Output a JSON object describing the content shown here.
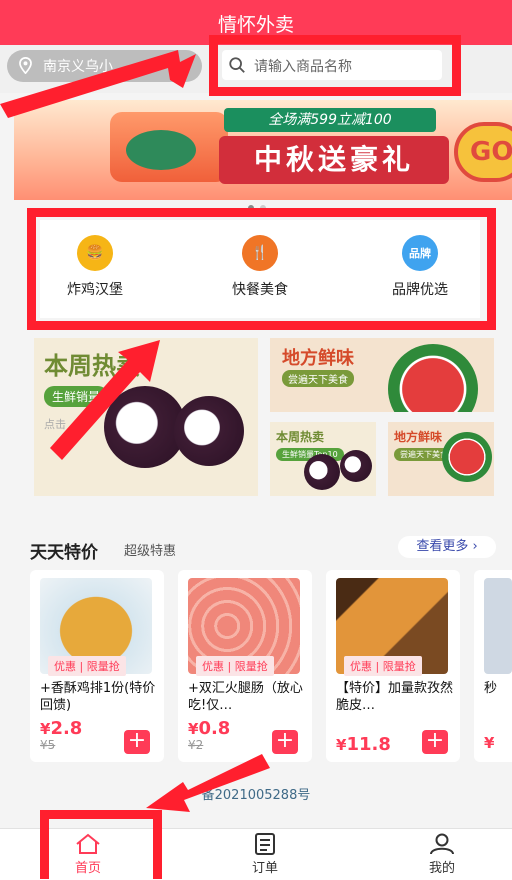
{
  "header": {
    "title": "情怀外卖",
    "bg_color": "#ff3b57"
  },
  "location": {
    "text": "南京义乌小",
    "icon": "location-pin-icon",
    "chevron": "›"
  },
  "search": {
    "placeholder": "请输入商品名称",
    "icon": "search-icon"
  },
  "banner": {
    "deal": "全场满599立减100",
    "headline": "中秋送豪礼",
    "go": "GO"
  },
  "categories": [
    {
      "label": "炸鸡汉堡",
      "icon": "fried-chicken-icon",
      "color": "#f6b516",
      "glyph": "🍔"
    },
    {
      "label": "快餐美食",
      "icon": "fork-knife-icon",
      "color": "#f07526",
      "glyph": "🍴"
    },
    {
      "label": "品牌优选",
      "icon": "brand-icon",
      "color": "#3fa3ef",
      "glyph": "品牌"
    }
  ],
  "promos": {
    "big": {
      "title": "本周热卖",
      "tag": "生鲜销量",
      "sub": "点击"
    },
    "top_right": {
      "title": "地方鲜味",
      "tag": "尝遍天下美食"
    },
    "small_left": {
      "title": "本周热卖",
      "tag": "生鲜销量Top10"
    },
    "small_right": {
      "title": "地方鲜味",
      "tag": "尝遍天下美食"
    }
  },
  "daily": {
    "title": "天天特价",
    "subtitle": "超级特惠",
    "more": "查看更多",
    "more_icon": "chevron-right-icon"
  },
  "products": [
    {
      "tag": "优惠 | 限量抢",
      "name": "+香酥鸡排1份(特价回馈)",
      "currency": "¥",
      "price": "2.8",
      "old": "¥5"
    },
    {
      "tag": "优惠 | 限量抢",
      "name": "+双汇火腿肠（放心吃!仅…",
      "currency": "¥",
      "price": "0.8",
      "old": "¥2"
    },
    {
      "tag": "优惠 | 限量抢",
      "name": "【特价】加量款孜然脆皮…",
      "currency": "¥",
      "price": "11.8",
      "old": ""
    },
    {
      "tag": "",
      "name": "秒",
      "currency": "¥",
      "price": "",
      "old": ""
    }
  ],
  "icp": "备2021005288号",
  "tabs": [
    {
      "label": "首页",
      "icon": "home-icon",
      "active": true
    },
    {
      "label": "订单",
      "icon": "order-list-icon",
      "active": false
    },
    {
      "label": "我的",
      "icon": "user-icon",
      "active": false
    }
  ],
  "colors": {
    "accent": "#ff3b57",
    "annotation": "#ff1f2e"
  }
}
